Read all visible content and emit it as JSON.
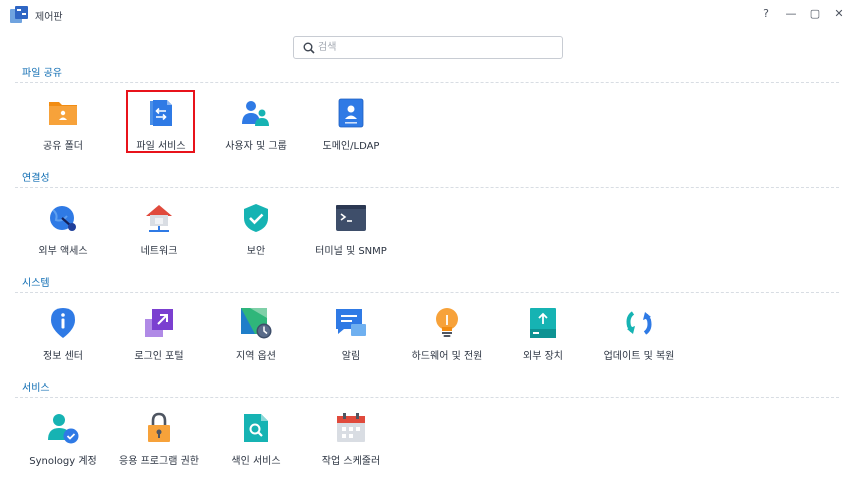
{
  "window": {
    "title": "제어판",
    "help": "?",
    "minimize": "—",
    "maximize": "▢",
    "close": "✕"
  },
  "search": {
    "placeholder": "검색",
    "value": ""
  },
  "sections": [
    {
      "title": "파일 공유",
      "items": [
        {
          "label": "공유 폴더",
          "icon": "shared-folder-icon"
        },
        {
          "label": "파일 서비스",
          "icon": "file-services-icon",
          "selected": true
        },
        {
          "label": "사용자 및 그룹",
          "icon": "user-group-icon"
        },
        {
          "label": "도메인/LDAP",
          "icon": "domain-ldap-icon"
        }
      ]
    },
    {
      "title": "연결성",
      "items": [
        {
          "label": "외부 액세스",
          "icon": "external-access-icon"
        },
        {
          "label": "네트워크",
          "icon": "network-icon"
        },
        {
          "label": "보안",
          "icon": "security-shield-icon"
        },
        {
          "label": "터미널 및 SNMP",
          "icon": "terminal-icon"
        }
      ]
    },
    {
      "title": "시스템",
      "items": [
        {
          "label": "정보 센터",
          "icon": "info-center-icon"
        },
        {
          "label": "로그인 포털",
          "icon": "login-portal-icon"
        },
        {
          "label": "지역 옵션",
          "icon": "regional-options-icon"
        },
        {
          "label": "알림",
          "icon": "notification-icon"
        },
        {
          "label": "하드웨어 및 전원",
          "icon": "hardware-power-icon"
        },
        {
          "label": "외부 장치",
          "icon": "external-devices-icon"
        },
        {
          "label": "업데이트 및 복원",
          "icon": "update-restore-icon"
        }
      ]
    },
    {
      "title": "서비스",
      "items": [
        {
          "label": "Synology 계정",
          "icon": "synology-account-icon"
        },
        {
          "label": "응용 프로그램 권한",
          "icon": "application-privileges-icon"
        },
        {
          "label": "색인 서비스",
          "icon": "indexing-service-icon"
        },
        {
          "label": "작업 스케줄러",
          "icon": "task-scheduler-icon"
        }
      ]
    }
  ],
  "colors": {
    "section_title": "#0f6db3",
    "highlight": "#e8131b",
    "icon_blue": "#2f7ae5",
    "icon_orange": "#f7941d",
    "icon_teal": "#16b3b3"
  }
}
